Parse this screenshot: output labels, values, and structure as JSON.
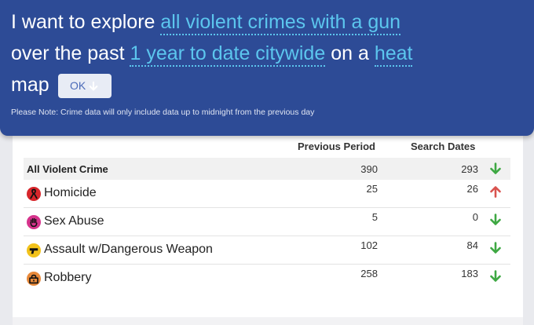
{
  "query": {
    "prefix": "I want to explore",
    "crime_option": "all violent crimes with a gun",
    "over_label": "over the past",
    "period_option": "1 year to date citywide",
    "on_a_label": "on a",
    "view_option": "heat",
    "map_label": "map",
    "ok_label": "OK",
    "note": "Please Note: Crime data will only include data up to midnight from the previous day"
  },
  "table": {
    "headers": {
      "previous": "Previous Period",
      "search": "Search Dates"
    },
    "total": {
      "label": "All Violent Crime",
      "previous": "390",
      "search": "293",
      "trend": "down"
    },
    "rows": [
      {
        "label": "Homicide",
        "icon": "homicide-icon",
        "previous": "25",
        "search": "26",
        "trend": "up"
      },
      {
        "label": "Sex Abuse",
        "icon": "sex-abuse-icon",
        "previous": "5",
        "search": "0",
        "trend": "down"
      },
      {
        "label": "Assault w/Dangerous Weapon",
        "icon": "assault-gun-icon",
        "previous": "102",
        "search": "84",
        "trend": "down"
      },
      {
        "label": "Robbery",
        "icon": "robbery-icon",
        "previous": "258",
        "search": "183",
        "trend": "down"
      }
    ]
  },
  "colors": {
    "header_bg": "#2d4b96",
    "option_link": "#5cc6ee",
    "trend_down": "#3ea843",
    "trend_up": "#d9534f"
  }
}
